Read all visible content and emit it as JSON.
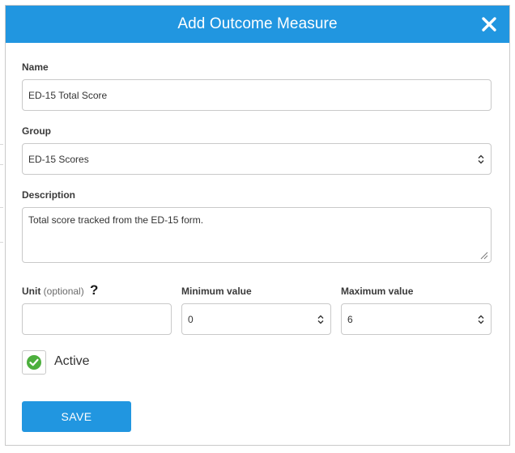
{
  "dialog": {
    "title": "Add Outcome Measure",
    "close_icon": "close-icon"
  },
  "form": {
    "name": {
      "label": "Name",
      "value": "ED-15 Total Score"
    },
    "group": {
      "label": "Group",
      "selected": "ED-15 Scores"
    },
    "description": {
      "label": "Description",
      "value": "Total score tracked from the ED-15 form."
    },
    "unit": {
      "label": "Unit",
      "optional_text": "(optional)",
      "help_text": "?",
      "value": ""
    },
    "minimum": {
      "label": "Minimum value",
      "value": "0"
    },
    "maximum": {
      "label": "Maximum value",
      "value": "6"
    },
    "active": {
      "label": "Active",
      "checked": true
    }
  },
  "actions": {
    "save_label": "SAVE"
  },
  "colors": {
    "header": "#2196e0",
    "button": "#2196e0",
    "check": "#4caf3d"
  }
}
